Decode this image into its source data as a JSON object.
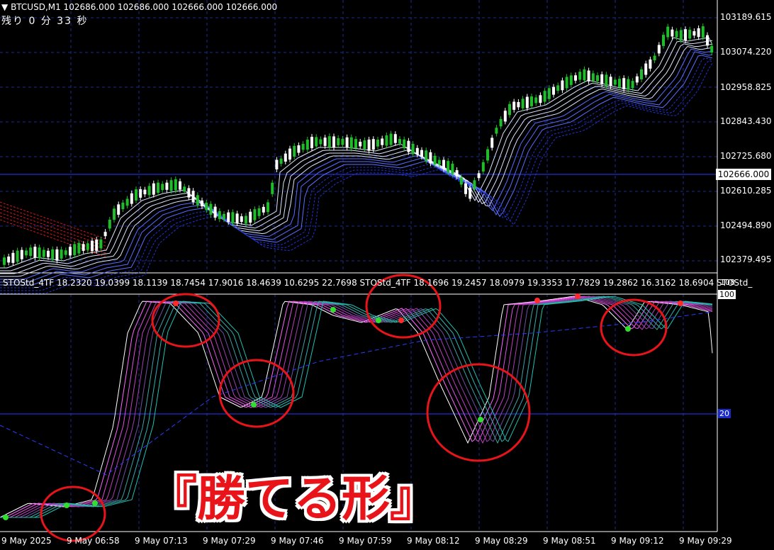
{
  "header": {
    "symbol_line": "BTCUSD,M1  102686.000 102686.000 102666.000 102666.000",
    "remaining": "残り 0 分 33 秒"
  },
  "price_axis": {
    "labels": [
      "103189.615",
      "103074.220",
      "102958.825",
      "102843.430",
      "102725.680",
      "102610.285",
      "102494.890",
      "102379.495"
    ],
    "current": "102666.000"
  },
  "subwindow": {
    "header": "STOStd_4TF 18.2320 19.0399 18.1139 18.7454 17.9016 18.4639 10.6295 22.7698  STOStd_4TF 18.1696 19.2457 18.0979 19.3353 17.7829 19.2862 16.3162 18.6904  STOStd_",
    "max_label": "108",
    "level_100": "100",
    "level_20": "20"
  },
  "time_axis": [
    "9 May 2025",
    "9 May 06:58",
    "9 May 07:13",
    "9 May 07:29",
    "9 May 07:46",
    "9 May 07:59",
    "9 May 08:12",
    "9 May 08:29",
    "9 May 08:51",
    "9 May 09:12",
    "9 May 09:29"
  ],
  "banner": "『勝てる形』",
  "colors": {
    "bull": "#1fbd2a",
    "bear": "#ffffff",
    "grid": "#1a2b8c",
    "circle": "#e8141a"
  }
}
